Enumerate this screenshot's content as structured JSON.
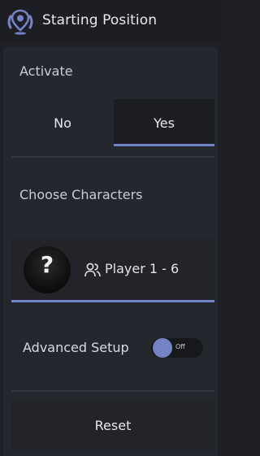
{
  "header": {
    "title": "Starting Position",
    "icon": "location-pin-icon"
  },
  "activate": {
    "label": "Activate",
    "options": [
      "No",
      "Yes"
    ],
    "selected": "Yes"
  },
  "characters": {
    "label": "Choose Characters",
    "avatar_placeholder": "?",
    "players_label": "Player 1 - 6",
    "players_icon": "users-icon"
  },
  "advanced": {
    "label": "Advanced Setup",
    "switch_label": "Off",
    "enabled": false
  },
  "reset": {
    "label": "Reset"
  },
  "colors": {
    "accent": "#7483c5",
    "background": "#1e2026",
    "surface": "#25272e"
  }
}
